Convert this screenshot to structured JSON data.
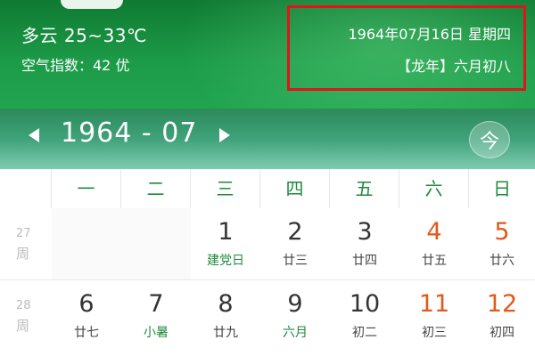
{
  "weather": {
    "text": "多云 25~33℃",
    "aqi": "空气指数：42 优"
  },
  "date": {
    "full": "1964年07月16日  星期四",
    "lunar": "【龙年】六月初八"
  },
  "nav": {
    "month": "1964 - 07",
    "today_icon": "今"
  },
  "weekdays": [
    "一",
    "二",
    "三",
    "四",
    "五",
    "六",
    "日"
  ],
  "weeks": [
    {
      "num": "27",
      "label": "周",
      "days": [
        {
          "day": "",
          "sub": ""
        },
        {
          "day": "",
          "sub": ""
        },
        {
          "day": "1",
          "sub": "建党日"
        },
        {
          "day": "2",
          "sub": "廿三"
        },
        {
          "day": "3",
          "sub": "廿四"
        },
        {
          "day": "4",
          "sub": "廿五"
        },
        {
          "day": "5",
          "sub": "廿六"
        }
      ]
    },
    {
      "num": "28",
      "label": "周",
      "days": [
        {
          "day": "6",
          "sub": "廿七"
        },
        {
          "day": "7",
          "sub": "小暑"
        },
        {
          "day": "8",
          "sub": "廿九"
        },
        {
          "day": "9",
          "sub": "六月"
        },
        {
          "day": "10",
          "sub": "初二"
        },
        {
          "day": "11",
          "sub": "初三"
        },
        {
          "day": "12",
          "sub": "初四"
        }
      ]
    }
  ],
  "colors": {
    "header_green": "#1c9a47",
    "highlight_box": "#e0141a",
    "weekend": "#e05a1b",
    "weekday_header": "#1e8a3e"
  }
}
